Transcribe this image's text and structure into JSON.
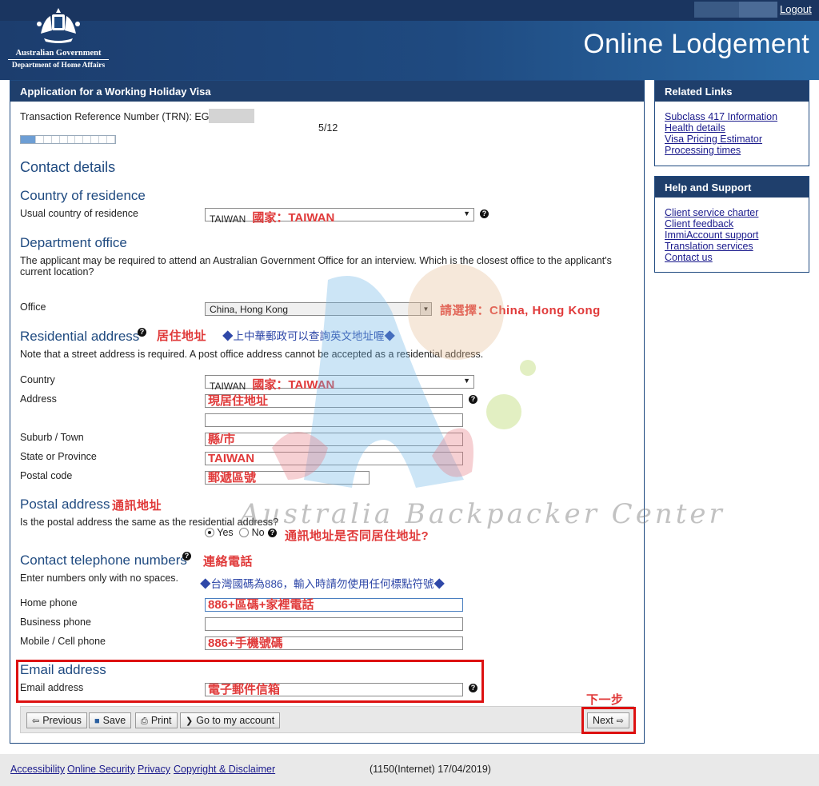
{
  "header": {
    "gov_name": "Australian Government",
    "dept_name": "Department of Home Affairs",
    "logout": "Logout",
    "title": "Online Lodgement"
  },
  "panel": {
    "title": "Application for a Working Holiday Visa",
    "trn_label": "Transaction Reference Number (TRN): EGO",
    "page_indicator": "5/12",
    "progress": {
      "current": 5,
      "total": 12
    }
  },
  "contact": {
    "title": "Contact details"
  },
  "residence": {
    "title": "Country of residence",
    "label": "Usual country of residence",
    "value": "TAIWAN",
    "annotation": "國家：TAIWAN"
  },
  "office": {
    "title": "Department office",
    "description": "The applicant may be required to attend an Australian Government Office for an interview. Which is the closest office to the applicant's current location?",
    "label": "Office",
    "value": "China, Hong Kong",
    "annotation": "請選擇：China, Hong Kong"
  },
  "residential": {
    "title": "Residential address",
    "annotation": "居住地址",
    "tip": "◆上中華郵政可以查詢英文地址喔◆",
    "note": "Note that a street address is required. A post office address cannot be accepted as a residential address.",
    "country_label": "Country",
    "country_value": "TAIWAN",
    "country_annotation": "國家：TAIWAN",
    "address_label": "Address",
    "address_value": "現居住地址",
    "suburb_label": "Suburb / Town",
    "suburb_value": "縣/市",
    "state_label": "State or Province",
    "state_value": "TAIWAN",
    "postal_label": "Postal code",
    "postal_value": "郵遞區號"
  },
  "postal": {
    "title": "Postal address",
    "annotation": "通訊地址",
    "question": "Is the postal address the same as the residential address?",
    "yes": "Yes",
    "no": "No",
    "selected": "Yes",
    "question_annotation": "通訊地址是否同居住地址?"
  },
  "phone": {
    "title": "Contact telephone numbers",
    "annotation": "連絡電話",
    "instruction": "Enter numbers only with no spaces.",
    "tip": "◆台灣國碼為886，輸入時請勿使用任何標點符號◆",
    "home_label": "Home phone",
    "home_value": "886+區碼+家裡電話",
    "business_label": "Business phone",
    "business_value": "",
    "mobile_label": "Mobile / Cell phone",
    "mobile_value": "886+手機號碼"
  },
  "email": {
    "title": "Email address",
    "label": "Email address",
    "value": "電子郵件信箱"
  },
  "toolbar": {
    "previous": "Previous",
    "save": "Save",
    "print": "Print",
    "account": "Go to my account",
    "next": "Next",
    "next_annotation": "下一步"
  },
  "related_links": {
    "title": "Related Links",
    "items": [
      "Subclass 417 Information",
      "Health details",
      "Visa Pricing Estimator",
      "Processing times"
    ]
  },
  "help_support": {
    "title": "Help and Support",
    "items": [
      "Client service charter",
      "Client feedback",
      "ImmiAccount support",
      "Translation services",
      "Contact us"
    ]
  },
  "footer": {
    "links": [
      "Accessibility",
      "Online Security",
      "Privacy",
      "Copyright & Disclaimer"
    ],
    "version": "(1150(Internet) 17/04/2019)"
  },
  "watermark": "Australia Backpacker Center",
  "colors": {
    "header_dark": "#1c3d6e",
    "header_accent": "#2a6aa6",
    "section_title": "#1f4a80",
    "annotation_red": "#e03a3a",
    "annotation_blue": "#2f48a8",
    "highlight_box": "#dd1111"
  }
}
